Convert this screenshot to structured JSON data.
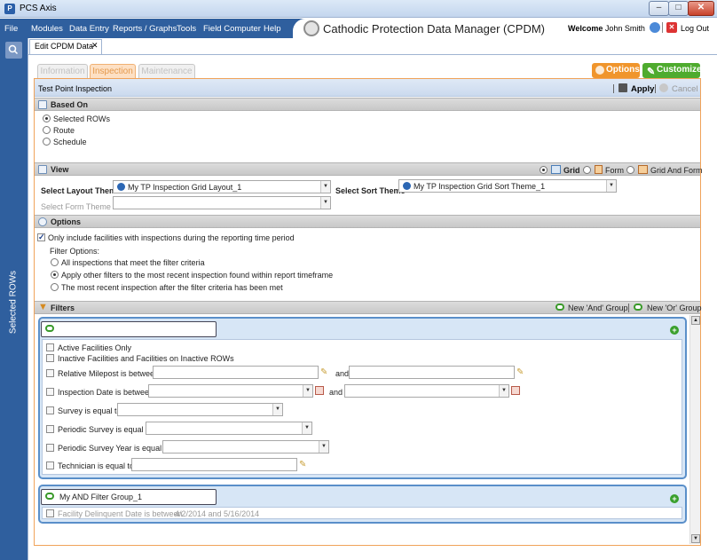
{
  "window": {
    "title": "PCS Axis",
    "app_icon": "pcs-logo-icon"
  },
  "menubar": {
    "items": [
      "File",
      "Modules",
      "Data Entry",
      "Reports / Graphs",
      "Tools",
      "Field Computer",
      "Help"
    ],
    "app_title": "Cathodic Protection Data Manager (CPDM)",
    "welcome_label": "Welcome",
    "user_name": "John Smith",
    "logout": "Log Out"
  },
  "leftbar": {
    "label": "Selected ROWs"
  },
  "doc_tab": {
    "label": "Edit CPDM Data",
    "close": "✕"
  },
  "page_tabs": [
    "Information",
    "Inspection",
    "Maintenance"
  ],
  "actions": {
    "options": "Options",
    "customize": "Customize"
  },
  "panel": {
    "title": "Test Point Inspection",
    "apply": "Apply",
    "cancel": "Cancel"
  },
  "based_on": {
    "header": "Based On",
    "options": [
      "Selected ROWs",
      "Route",
      "Schedule"
    ],
    "selected": "Selected ROWs"
  },
  "view": {
    "header": "View",
    "modes": [
      "Grid",
      "Form",
      "Grid And Form"
    ],
    "selected_mode": "Grid",
    "layout_label": "Select Layout Theme",
    "layout_value": "My TP Inspection Grid Layout_1",
    "sort_label": "Select Sort Theme",
    "sort_value": "My TP Inspection Grid Sort Theme_1",
    "form_label": "Select Form Theme",
    "form_value": ""
  },
  "options": {
    "header": "Options",
    "only_include": "Only include facilities with inspections during the reporting time period",
    "only_include_checked": true,
    "filter_options_label": "Filter Options:",
    "filter_options": [
      "All inspections that meet the filter criteria",
      "Apply other filters to the most recent inspection found within report timeframe",
      "The most recent inspection after the filter criteria has been met"
    ],
    "filter_selected": 1
  },
  "filters": {
    "header": "Filters",
    "new_and": "New 'And' Group",
    "new_or": "New 'Or' Group",
    "group1": {
      "name": "",
      "rows": {
        "active": "Active Facilities Only",
        "inactive": "Inactive Facilities and Facilities on Inactive ROWs",
        "milepost": "Relative Milepost is between",
        "milepost_and": "and",
        "insp_date": "Inspection Date is between",
        "insp_date_and": "and",
        "survey": "Survey is equal to",
        "periodic_survey": "Periodic Survey is equal to",
        "periodic_year": "Periodic Survey Year is equal to",
        "technician": "Technician is equal to"
      }
    },
    "group2": {
      "name": "My AND Filter Group_1",
      "delinquent_label": "Facility Delinquent Date is between",
      "delinquent_value": "4/2/2014  and  5/16/2014"
    }
  },
  "colors": {
    "menubar": "#2f5f9e",
    "accent_orange": "#f0952c",
    "accent_green": "#4eab2e"
  }
}
